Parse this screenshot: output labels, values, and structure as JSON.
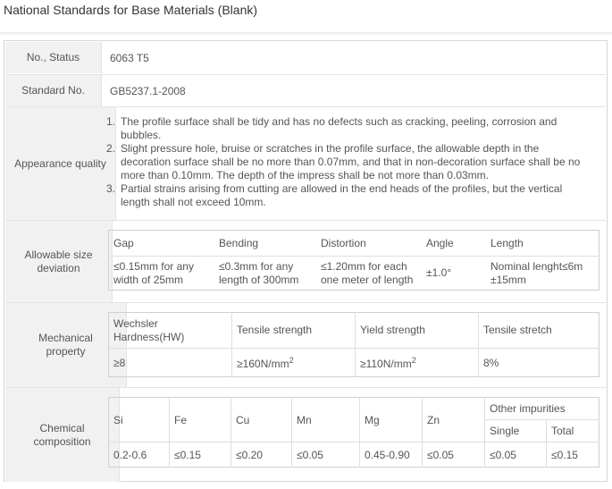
{
  "page": {
    "title": "National Standards for Base Materials (Blank)"
  },
  "rows": {
    "status": {
      "label": "No., Status",
      "value": "6063 T5"
    },
    "standard": {
      "label": "Standard No.",
      "value": "GB5237.1-2008"
    },
    "appearance": {
      "label": "Appearance quality",
      "items": [
        {
          "num": "1.",
          "text": "The profile surface shall be tidy and has no defects such as cracking, peeling, corrosion and bubbles."
        },
        {
          "num": "2.",
          "text": "Slight pressure hole, bruise or scratches in the profile surface, the allowable depth in the decoration surface shall be no more than 0.07mm, and that in non-decoration surface shall be no more than 0.10mm. The depth of the impress shall be not more than 0.03mm."
        },
        {
          "num": "3.",
          "text": "Partial strains arising from cutting are allowed in the end heads of the profiles, but the vertical length shall not exceed 10mm."
        }
      ]
    },
    "size": {
      "label": "Allowable size deviation",
      "headers": [
        "Gap",
        "Bending",
        "Distortion",
        "Angle",
        "Length"
      ],
      "values": [
        "≤0.15mm for any width of 25mm",
        "≤0.3mm for any length of 300mm",
        "≤1.20mm for each one meter of length",
        "±1.0°",
        "Nominal lenght≤6m ±15mm"
      ]
    },
    "mechanical": {
      "label": "Mechanical property",
      "headers": [
        "Wechsler Hardness(HW)",
        "Tensile strength",
        "Yield strength",
        "Tensile stretch"
      ],
      "values": [
        "≥8",
        "≥160N/mm",
        "≥110N/mm",
        "8%"
      ],
      "superscript": "2"
    },
    "chemical": {
      "label": "Chemical composition",
      "headers": [
        "Si",
        "Fe",
        "Cu",
        "Mn",
        "Mg",
        "Zn"
      ],
      "impurities": {
        "label": "Other impurities",
        "single": "Single",
        "total": "Total"
      },
      "values": [
        "0.2-0.6",
        "≤0.15",
        "≤0.20",
        "≤0.05",
        "0.45-0.90",
        "≤0.05",
        "≤0.05",
        "≤0.15"
      ]
    }
  }
}
